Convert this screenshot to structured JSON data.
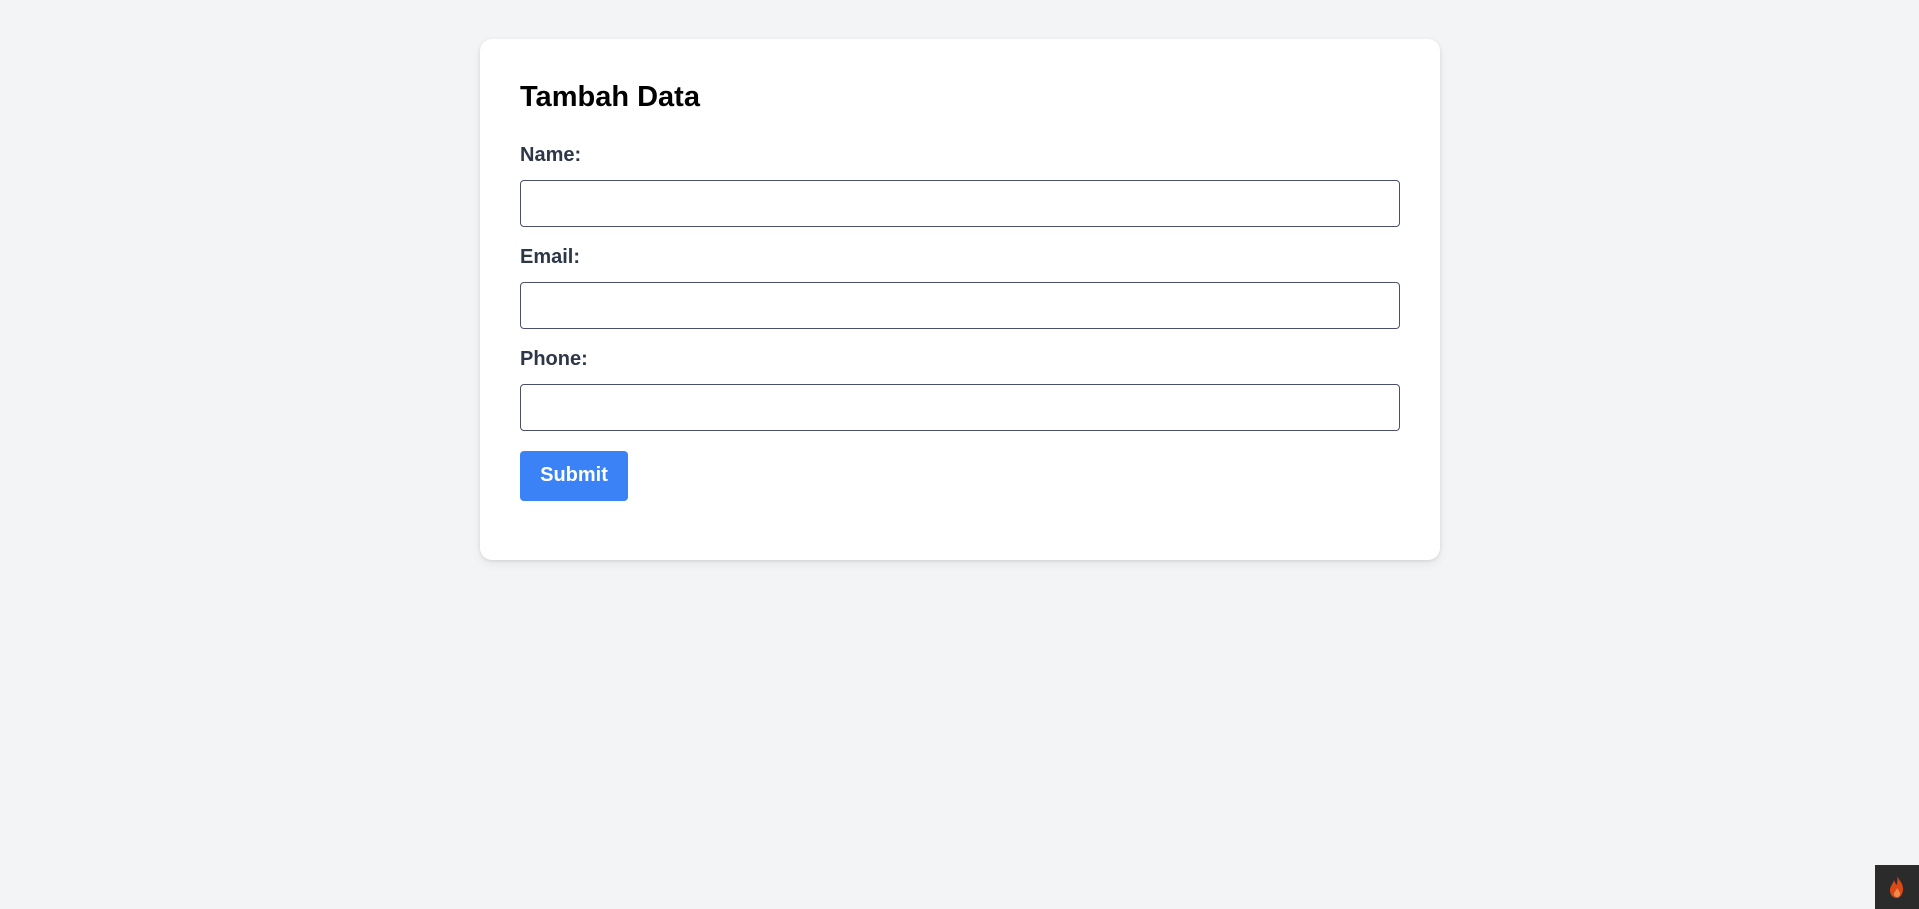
{
  "form": {
    "title": "Tambah Data",
    "fields": [
      {
        "label": "Name:",
        "value": "",
        "placeholder": ""
      },
      {
        "label": "Email:",
        "value": "",
        "placeholder": ""
      },
      {
        "label": "Phone:",
        "value": "",
        "placeholder": ""
      }
    ],
    "submit_label": "Submit"
  },
  "colors": {
    "page_background": "#f3f4f6",
    "card_background": "#ffffff",
    "label_text": "#2d3748",
    "input_border": "#4a5068",
    "submit_button": "#3b82f6",
    "corner_widget": "#2b2b2b",
    "flame_icon": "#dd4814"
  },
  "icons": {
    "corner_widget": "flame-icon"
  }
}
